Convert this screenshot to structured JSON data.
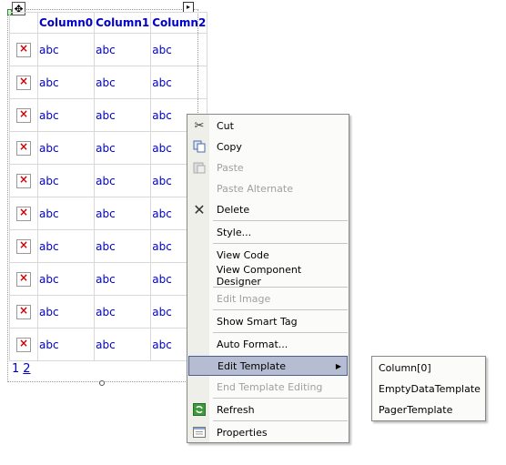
{
  "grid": {
    "headers": [
      "Column0",
      "Column1",
      "Column2"
    ],
    "rows": [
      [
        "abc",
        "abc",
        "abc"
      ],
      [
        "abc",
        "abc",
        "abc"
      ],
      [
        "abc",
        "abc",
        "abc"
      ],
      [
        "abc",
        "abc",
        "abc"
      ],
      [
        "abc",
        "abc",
        "abc"
      ],
      [
        "abc",
        "abc",
        "abc"
      ],
      [
        "abc",
        "abc",
        "abc"
      ],
      [
        "abc",
        "abc",
        "abc"
      ],
      [
        "abc",
        "abc",
        "abc"
      ],
      [
        "abc",
        "abc",
        "abc"
      ]
    ],
    "pager": [
      "1",
      "2"
    ]
  },
  "menu": {
    "items": [
      {
        "label": "Cut",
        "icon": "scissors-icon",
        "enabled": true
      },
      {
        "label": "Copy",
        "icon": "copy-icon",
        "enabled": true
      },
      {
        "label": "Paste",
        "icon": "paste-icon",
        "enabled": false
      },
      {
        "label": "Paste Alternate",
        "icon": "",
        "enabled": false
      },
      {
        "label": "Delete",
        "icon": "delete-x-icon",
        "enabled": true
      },
      {
        "label": "Style...",
        "icon": "",
        "enabled": true
      },
      {
        "label": "View Code",
        "icon": "",
        "enabled": true
      },
      {
        "label": "View Component Designer",
        "icon": "",
        "enabled": true
      },
      {
        "label": "Edit Image",
        "icon": "",
        "enabled": false
      },
      {
        "label": "Show Smart Tag",
        "icon": "",
        "enabled": true
      },
      {
        "label": "Auto Format...",
        "icon": "",
        "enabled": true
      },
      {
        "label": "Edit Template",
        "icon": "",
        "enabled": true,
        "highlighted": true,
        "submenu": true
      },
      {
        "label": "End Template Editing",
        "icon": "",
        "enabled": false
      },
      {
        "label": "Refresh",
        "icon": "refresh-icon",
        "enabled": true
      },
      {
        "label": "Properties",
        "icon": "properties-icon",
        "enabled": true
      }
    ]
  },
  "submenu": {
    "items": [
      "Column[0]",
      "EmptyDataTemplate",
      "PagerTemplate"
    ]
  }
}
